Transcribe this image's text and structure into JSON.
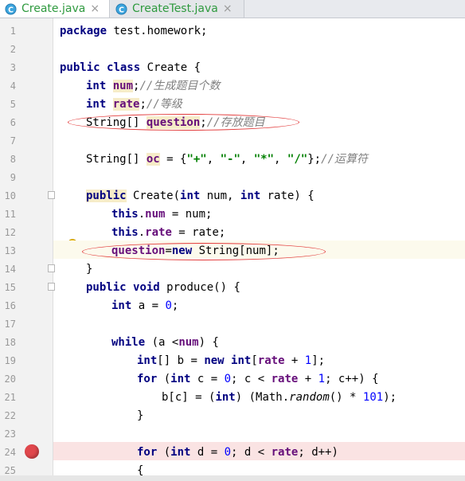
{
  "tabs": [
    {
      "name": "Create.java",
      "active": true
    },
    {
      "name": "CreateTest.java",
      "active": false
    }
  ],
  "tab_close_glyph": "×",
  "line_numbers": [
    "1",
    "2",
    "3",
    "4",
    "5",
    "6",
    "7",
    "8",
    "9",
    "10",
    "11",
    "12",
    "13",
    "14",
    "15",
    "16",
    "17",
    "18",
    "19",
    "20",
    "21",
    "22",
    "23",
    "24",
    "25"
  ],
  "code": {
    "l1": [
      "package",
      " test.homework;"
    ],
    "l3": [
      "public",
      " ",
      "class",
      " Create {"
    ],
    "l4": [
      "int",
      " ",
      "num",
      ";",
      "//生成题目个数"
    ],
    "l5": [
      "int",
      " ",
      "rate",
      ";",
      "//等级"
    ],
    "l6": [
      "String[] ",
      "question",
      ";",
      "//存放题目"
    ],
    "l8": [
      "String[] ",
      "oc",
      " = {",
      "\"+\"",
      ", ",
      "\"-\"",
      ", ",
      "\"*\"",
      ", ",
      "\"/\"",
      "};",
      "//运算符"
    ],
    "l10": [
      "public",
      " Create(",
      "int",
      " num, ",
      "int",
      " rate) {"
    ],
    "l11": [
      "this",
      ".",
      "num",
      " = num;"
    ],
    "l12": [
      "this",
      ".",
      "rate",
      " = rate;"
    ],
    "l13": [
      "question",
      "=",
      "new",
      " String[num];"
    ],
    "l14": [
      "}"
    ],
    "l15": [
      "public",
      " ",
      "void",
      " produce() {"
    ],
    "l16": [
      "int",
      " a = ",
      "0",
      ";"
    ],
    "l18": [
      "while",
      " (a <",
      "num",
      ") {"
    ],
    "l19": [
      "int",
      "[] b = ",
      "new",
      " ",
      "int",
      "[",
      "rate",
      " + ",
      "1",
      "];"
    ],
    "l20": [
      "for",
      " (",
      "int",
      " c = ",
      "0",
      "; c < ",
      "rate",
      " + ",
      "1",
      "; c++) {"
    ],
    "l21": [
      "b[c] = (",
      "int",
      ") (Math.",
      "random",
      "() * ",
      "101",
      ");"
    ],
    "l22": [
      "}"
    ],
    "l24": [
      "for",
      " (",
      "int",
      " d = ",
      "0",
      "; d < ",
      "rate",
      "; d++)"
    ],
    "l25": [
      "{"
    ]
  },
  "colors": {
    "keyword": "#000080",
    "field": "#660e7a",
    "comment": "#808080",
    "string": "#008000",
    "number": "#0000ff",
    "annotation": "#e23a3a",
    "breakpoint": "#e0474c",
    "tab_text": "#2f9a3f"
  },
  "icons": [
    "java-class-icon",
    "close-icon",
    "intention-bulb-icon",
    "breakpoint-icon",
    "fold-icon"
  ]
}
